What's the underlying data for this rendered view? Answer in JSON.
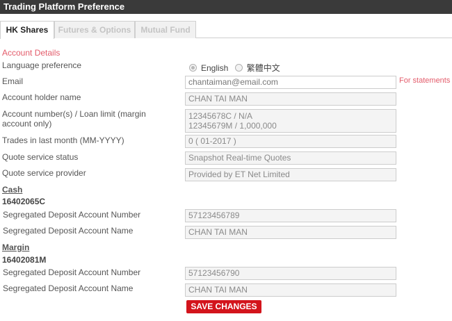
{
  "window": {
    "title": "Trading Platform Preference"
  },
  "tabs": [
    {
      "label": "HK Shares",
      "active": true
    },
    {
      "label": "Futures & Options",
      "active": false
    },
    {
      "label": "Mutual Fund",
      "active": false
    }
  ],
  "account_details": {
    "section_title": "Account Details",
    "language": {
      "label": "Language preference",
      "options": [
        "English",
        "繁體中文"
      ],
      "selected": "English"
    },
    "email": {
      "label": "Email",
      "value": "chantaiman@email.com",
      "note": "For statements"
    },
    "holder": {
      "label": "Account holder name",
      "value": "CHAN TAI MAN"
    },
    "account_numbers": {
      "label_line1": "Account number(s) / Loan limit (margin",
      "label_line2": "account only)",
      "value_line1": "12345678C / N/A",
      "value_line2": "12345679M / 1,000,000"
    },
    "trades": {
      "label": "Trades in last month (MM-YYYY)",
      "value": "0   ( 01-2017 )"
    },
    "quote_status": {
      "label": "Quote service status",
      "value": "Snapshot Real-time Quotes"
    },
    "quote_provider": {
      "label": "Quote service provider",
      "value": "Provided by ET Net Limited"
    }
  },
  "cash": {
    "heading": "Cash",
    "account_id": "16402065C",
    "deposit_number": {
      "label": "Segregated Deposit Account Number",
      "value": "57123456789"
    },
    "deposit_name": {
      "label": "Segregated Deposit Account Name",
      "value": "CHAN TAI MAN"
    }
  },
  "margin": {
    "heading": "Margin",
    "account_id": "16402081M",
    "deposit_number": {
      "label": "Segregated Deposit Account Number",
      "value": "57123456790"
    },
    "deposit_name": {
      "label": "Segregated Deposit Account Name",
      "value": "CHAN TAI MAN"
    }
  },
  "actions": {
    "save_label": "SAVE CHANGES"
  },
  "colors": {
    "titlebar": "#3a3a3a",
    "accent_red": "#d3141c",
    "section_pink": "#e35b6a"
  }
}
